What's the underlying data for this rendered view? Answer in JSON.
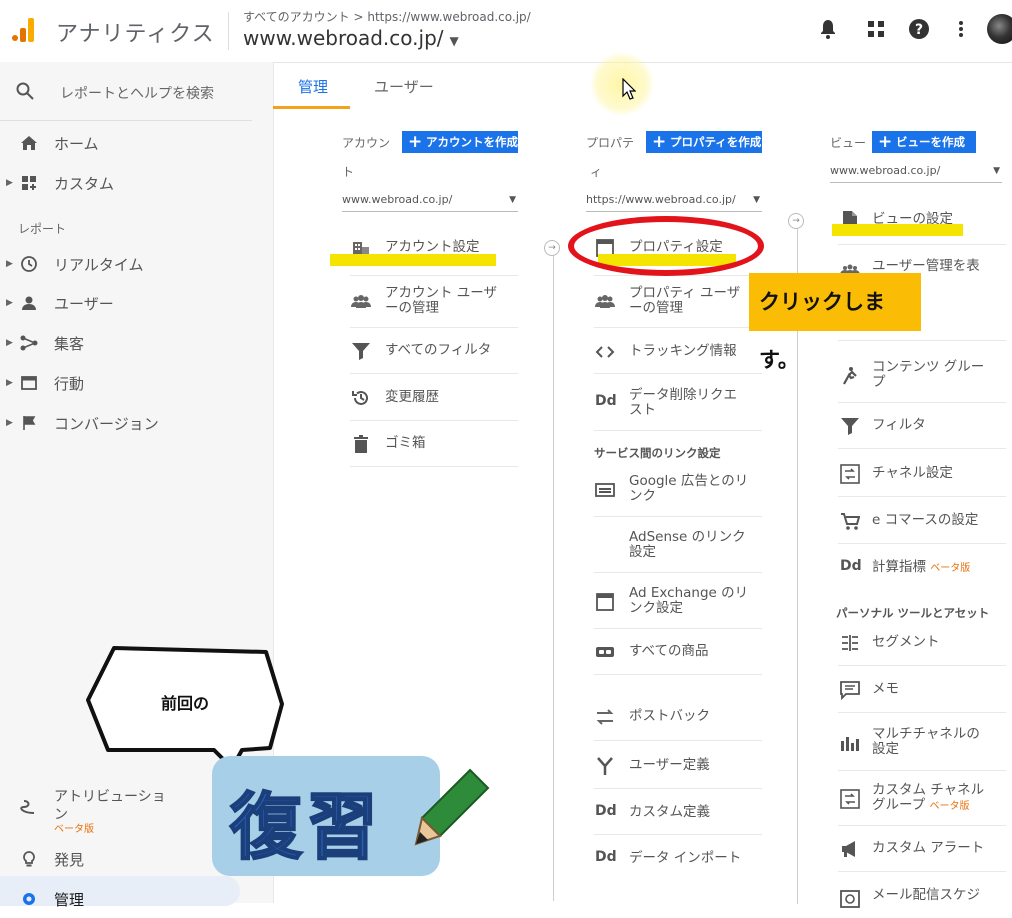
{
  "header": {
    "app_title": "アナリティクス",
    "breadcrumb": "すべてのアカウント > https://www.webroad.co.jp/",
    "site": "www.webroad.co.jp/",
    "logo_colors": [
      "#f9ab00",
      "#e37400",
      "#e37400"
    ]
  },
  "sidebar": {
    "search_placeholder": "レポートとヘルプを検索",
    "items_top": [
      {
        "label": "ホーム",
        "icon": "home-icon"
      },
      {
        "label": "カスタム",
        "icon": "dashboard-icon"
      }
    ],
    "reports_label": "レポート",
    "reports": [
      {
        "label": "リアルタイム",
        "icon": "clock-icon"
      },
      {
        "label": "ユーザー",
        "icon": "person-icon"
      },
      {
        "label": "集客",
        "icon": "share-icon"
      },
      {
        "label": "行動",
        "icon": "window-icon"
      },
      {
        "label": "コンバージョン",
        "icon": "flag-icon"
      }
    ],
    "attribution_line1": "アトリビューショ",
    "attribution_line2": "ン",
    "attribution_beta": "ベータ版",
    "discover": "発見",
    "admin": "管理"
  },
  "tabs": [
    {
      "label": "管理",
      "active": true
    },
    {
      "label": "ユーザー",
      "active": false
    }
  ],
  "account_col": {
    "head_line1": "アカウン",
    "head_line2": "ト",
    "create_button": "アカウントを作成",
    "selected": "www.webroad.co.jp/",
    "items": [
      {
        "line1": "アカウント設定",
        "line2": "",
        "icon": "building-icon"
      },
      {
        "line1": "アカウント ユーザ",
        "line2": "ーの管理",
        "icon": "people-icon"
      },
      {
        "line1": "すべてのフィルタ",
        "line2": "",
        "icon": "filter-icon"
      },
      {
        "line1": "変更履歴",
        "line2": "",
        "icon": "history-icon"
      },
      {
        "line1": "ゴミ箱",
        "line2": "",
        "icon": "trash-icon"
      }
    ]
  },
  "property_col": {
    "head_line1": "プロパテ",
    "head_line2": "ィ",
    "create_button": "プロパティを作成",
    "selected": "https://www.webroad.co.jp/",
    "items": [
      {
        "line1": "プロパティ設定",
        "line2": "",
        "icon": "window-icon"
      },
      {
        "line1": "プロパティ ユーザ",
        "line2": "ーの管理",
        "icon": "people-icon"
      },
      {
        "line1": "トラッキング情報",
        "line2": "",
        "icon": "code-icon"
      },
      {
        "line1": "データ削除リクエ",
        "line2": "スト",
        "icon": "dd-icon"
      }
    ],
    "section_label": "サービス間のリンク設定",
    "link_items": [
      {
        "line1": "Google 広告とのリ",
        "line2": "ンク",
        "icon": "ads-icon"
      },
      {
        "line1": "AdSense のリンク",
        "line2": "設定",
        "icon": ""
      },
      {
        "line1": "Ad Exchange のリ",
        "line2": "ンク設定",
        "icon": "window-icon"
      },
      {
        "line1": "すべての商品",
        "line2": "",
        "icon": "link-icon"
      },
      {
        "line1": "ポストバック",
        "line2": "",
        "icon": "swap-icon"
      },
      {
        "line1": "ユーザー定義",
        "line2": "",
        "icon": "fork-icon"
      },
      {
        "line1": "カスタム定義",
        "line2": "",
        "icon": "dd-icon"
      },
      {
        "line1": "データ インポート",
        "line2": "",
        "icon": "dd-icon"
      }
    ]
  },
  "view_col": {
    "head": "ビュー",
    "create_button": "ビューを作成",
    "selected": "www.webroad.co.jp/",
    "items": [
      {
        "line1": "ビューの設定",
        "line2": "",
        "icon": "doc-icon"
      },
      {
        "line1": "ユーザー管理を表",
        "line2": "",
        "icon": "people-icon"
      },
      {
        "line1": "コンテンツ グルー",
        "line2": "プ",
        "icon": "person-run-icon"
      },
      {
        "line1": "フィルタ",
        "line2": "",
        "icon": "filter-icon"
      },
      {
        "line1": "チャネル設定",
        "line2": "",
        "icon": "channel-icon"
      },
      {
        "line1": "e コマースの設定",
        "line2": "",
        "icon": "cart-icon"
      },
      {
        "line1": "計算指標",
        "line2": "",
        "icon": "dd-icon",
        "beta": "ベータ版"
      }
    ],
    "section_label": "パーソナル ツールとアセット",
    "tool_items": [
      {
        "line1": "セグメント",
        "line2": "",
        "icon": "segment-icon"
      },
      {
        "line1": "メモ",
        "line2": "",
        "icon": "memo-icon"
      },
      {
        "line1": "マルチチャネルの",
        "line2": "設定",
        "icon": "bars-icon"
      },
      {
        "line1": "カスタム チャネル",
        "line2": "グループ",
        "icon": "channel-icon",
        "beta": "ベータ版"
      },
      {
        "line1": "カスタム アラート",
        "line2": "",
        "icon": "megaphone-icon"
      },
      {
        "line1": "メール配信スケジ",
        "line2": "",
        "icon": "clock-icon"
      }
    ]
  },
  "overlay": {
    "callout": "クリックします。",
    "bubble": "前回の",
    "fukushu": "復習",
    "highlight_color": "#f5e300",
    "circle_color": "#e3131b"
  }
}
